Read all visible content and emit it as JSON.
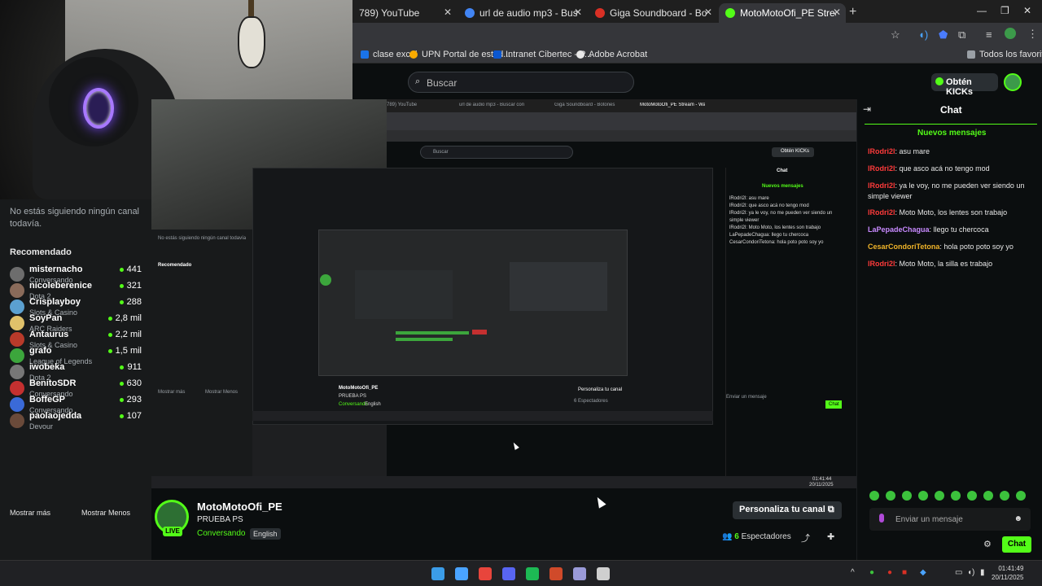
{
  "tabs": [
    {
      "label": "789) YouTube",
      "color": "#ff0000"
    },
    {
      "label": "url de audio mp3 - Buscar con",
      "color": "#4285f4"
    },
    {
      "label": "Giga Soundboard - Botones de",
      "color": "#d93025"
    },
    {
      "label": "MotoMotoOfi_PE Stream - Wat",
      "color": "#53fc18",
      "active": true
    }
  ],
  "bookmarks": [
    {
      "label": "clase excel",
      "color": "#1a73e8"
    },
    {
      "label": "UPN Portal de estud...",
      "color": "#f9ab00"
    },
    {
      "label": "Intranet Cibertec - P...",
      "color": "#0b57d0"
    },
    {
      "label": "Adobe Acrobat",
      "color": "#e8e8e8"
    }
  ],
  "bookmarks_right": "Todos los favoritos",
  "search": {
    "placeholder": "Buscar"
  },
  "header": {
    "kicks": "Obtén KICKs"
  },
  "sidebar": {
    "empty_text": "No estás siguiendo ningún canal todavía.",
    "recommended_title": "Recomendado",
    "channels": [
      {
        "name": "misternacho",
        "category": "Conversando",
        "viewers": "441",
        "color": "#6d6d6d"
      },
      {
        "name": "nicoleberenice",
        "category": "Dota 2",
        "viewers": "321",
        "color": "#8a6b5a"
      },
      {
        "name": "Crisplayboy",
        "category": "Slots & Casino",
        "viewers": "288",
        "color": "#5ba0d0"
      },
      {
        "name": "SoyPan",
        "category": "ARC Raiders",
        "viewers": "2,8 mil",
        "color": "#e0c16a"
      },
      {
        "name": "Antaurus",
        "category": "Slots & Casino",
        "viewers": "2,2 mil",
        "color": "#b83a2a"
      },
      {
        "name": "grafo",
        "category": "League of Legends",
        "viewers": "1,5 mil",
        "color": "#3ca63c"
      },
      {
        "name": "iwobeka",
        "category": "Dota 2",
        "viewers": "911",
        "color": "#777"
      },
      {
        "name": "BenitoSDR",
        "category": "Conversando",
        "viewers": "630",
        "color": "#c43030"
      },
      {
        "name": "BoffeGP",
        "category": "Conversando",
        "viewers": "293",
        "color": "#3a6ad8"
      },
      {
        "name": "paolaojedda",
        "category": "Devour",
        "viewers": "107",
        "color": "#6a4a3a"
      }
    ],
    "show_more": "Mostrar más",
    "show_less": "Mostrar Menos"
  },
  "stream": {
    "streamer": "MotoMotoOfi_PE",
    "title": "PRUEBA PS",
    "category": "Conversando",
    "language": "English",
    "live_badge": "LIVE",
    "customize": "Personaliza tu canal",
    "viewers_count": "6",
    "viewers_label": "Espectadores"
  },
  "chat": {
    "title": "Chat",
    "new_messages": "Nuevos mensajes",
    "messages": [
      {
        "user": "lRodri2l",
        "text": ": asu mare",
        "color": "#ff3b3b"
      },
      {
        "user": "lRodri2l",
        "text": ": que asco acá no tengo mod",
        "color": "#ff3b3b"
      },
      {
        "user": "lRodri2l",
        "text": ": ya le voy, no me pueden ver siendo un simple viewer",
        "color": "#ff3b3b"
      },
      {
        "user": "lRodri2l",
        "text": ": Moto Moto, los lentes son trabajo",
        "color": "#ff3b3b"
      },
      {
        "user": "LaPepadeChagua",
        "text": ": llego tu chercoca",
        "color": "#c88aff"
      },
      {
        "user": "CesarCondoriTetona",
        "text": ": hola poto poto soy yo",
        "color": "#f0b429"
      },
      {
        "user": "lRodri2l",
        "text": ": Moto Moto, la silla es trabajo",
        "color": "#ff3b3b"
      }
    ],
    "input_placeholder": "Enviar un mensaje",
    "send_label": "Chat"
  },
  "share_text": {
    "tab1": "789) YouTube",
    "tab2": "url de audio mp3 - Buscar con",
    "tab3": "Giga Soundboard - Botones de",
    "tab4": "MotoMotoOfi_PE Stream - Wat",
    "search": "Buscar",
    "kicks": "Obtén KICKs",
    "chat": "Chat",
    "new_messages": "Nuevos mensajes",
    "empty": "No estás siguiendo ningún canal todavía",
    "recommended": "Recomendado",
    "streamer": "MotoMotoOfi_PE",
    "title": "PRUEBA PS",
    "category": "Conversando",
    "language": "English",
    "customize": "Personaliza tu canal",
    "viewers": "6 Espectadores",
    "show_more": "Mostrar más",
    "show_less": "Mostrar Menos",
    "input": "Enviar un mensaje",
    "send": "Chat",
    "clock_time": "01:41:44",
    "clock_date": "20/11/2025",
    "chat_lines": [
      "lRodri2l: asu mare",
      "lRodri2l: que asco acá no tengo mod",
      "lRodri2l: ya le voy, no me pueden ver siendo un",
      "simple viewer",
      "lRodri2l: Moto Moto, los lentes son trabajo",
      "LaPepadeChagua: llego tu chercoca",
      "CesarCondoriTetona: hola poto poto soy yo"
    ]
  },
  "taskbar": {
    "time": "01:41:49",
    "date": "20/11/2025",
    "apps": [
      {
        "name": "windows-start-icon",
        "color": "#3b9ce8"
      },
      {
        "name": "file-explorer-icon",
        "color": "#4aa3ff"
      },
      {
        "name": "chrome-icon",
        "color": "#e8453c"
      },
      {
        "name": "discord-icon",
        "color": "#5865f2"
      },
      {
        "name": "spotify-icon",
        "color": "#1db954"
      },
      {
        "name": "flstudio-icon",
        "color": "#d04a2a"
      },
      {
        "name": "app-icon",
        "color": "#9a9ad8"
      },
      {
        "name": "obs-icon",
        "color": "#cfcfcf"
      }
    ]
  }
}
